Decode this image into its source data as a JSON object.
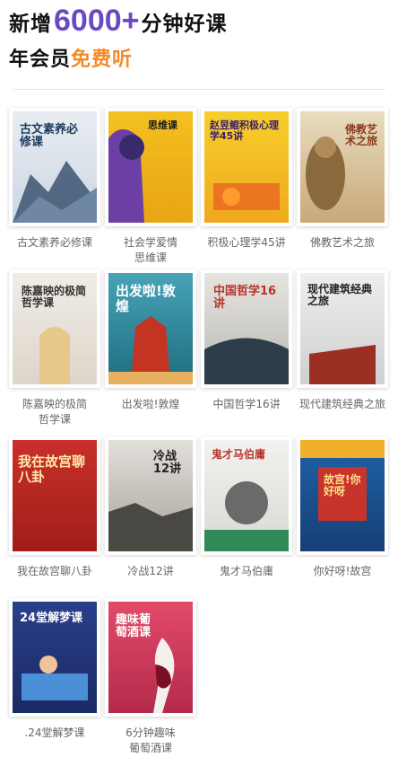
{
  "hero": {
    "line1_prefix": "新增",
    "line1_number": "6000+",
    "line1_suffix": "分钟好课",
    "line2_prefix": "年会员",
    "line2_accent": "免费听"
  },
  "courses": [
    {
      "caption": "古文素养必修课",
      "cover_title": "古文素养必修课",
      "color": "#e9edf2"
    },
    {
      "caption": "社会学爱情\n思维课",
      "cover_title": "思维课",
      "color": "#f4c020"
    },
    {
      "caption": "积极心理学45讲",
      "cover_title": "赵昱鲲积极心理学45讲",
      "color": "#f6cf2a"
    },
    {
      "caption": "佛教艺术之旅",
      "cover_title": "佛教艺术之旅",
      "color": "#e8dcc0"
    },
    {
      "caption": "陈嘉映的极简\n哲学课",
      "cover_title": "陈嘉映的极简哲学课",
      "color": "#f1ede6"
    },
    {
      "caption": "出发啦!敦煌",
      "cover_title": "出发啦!敦煌",
      "color": "#47a3b6"
    },
    {
      "caption": "中国哲学16讲",
      "cover_title": "中国哲学16讲",
      "color": "#e7e5e0"
    },
    {
      "caption": "现代建筑经典之旅",
      "cover_title": "现代建筑经典之旅",
      "color": "#eeeeee"
    },
    {
      "caption": "我在故宫聊八卦",
      "cover_title": "我在故宫聊八卦",
      "color": "#c9302a"
    },
    {
      "caption": "冷战12讲",
      "cover_title": "冷战12讲",
      "color": "#e2dfda"
    },
    {
      "caption": "鬼才马伯庸",
      "cover_title": "鬼才马伯庸",
      "color": "#f2f2ef"
    },
    {
      "caption": "你好呀!故宫",
      "cover_title": "故宫!你好呀",
      "color": "#1f62a8"
    },
    {
      "caption": ".24堂解梦课",
      "cover_title": "24堂解梦课",
      "color": "#2a3f8a"
    },
    {
      "caption": "6分钟趣味\n葡萄酒课",
      "cover_title": "趣味葡萄酒课",
      "color": "#e34a6a"
    }
  ]
}
